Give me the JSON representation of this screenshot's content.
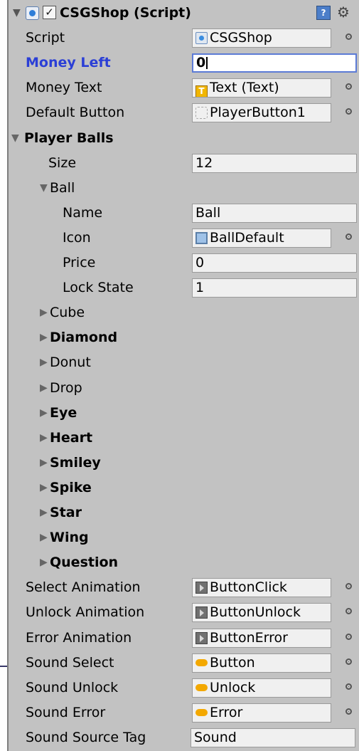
{
  "header": {
    "title": "CSGShop (Script)",
    "foldout": "▼",
    "checkbox": "✓",
    "help_icon": "?",
    "gear_icon": "⚙"
  },
  "fields": {
    "script": {
      "label": "Script",
      "value": "CSGShop"
    },
    "money_left": {
      "label": "Money Left",
      "value": "0"
    },
    "money_text": {
      "label": "Money Text",
      "value": "Text (Text)"
    },
    "default_button": {
      "label": "Default Button",
      "value": "PlayerButton1"
    }
  },
  "player_balls": {
    "label": "Player Balls",
    "size": {
      "label": "Size",
      "value": "12"
    },
    "ball": {
      "label": "Ball",
      "name": {
        "label": "Name",
        "value": "Ball"
      },
      "icon": {
        "label": "Icon",
        "value": "BallDefault"
      },
      "price": {
        "label": "Price",
        "value": "0"
      },
      "lock_state": {
        "label": "Lock State",
        "value": "1"
      }
    },
    "items": [
      "Cube",
      "Diamond",
      "Donut",
      "Drop",
      "Eye",
      "Heart",
      "Smiley",
      "Spike",
      "Star",
      "Wing",
      "Question"
    ]
  },
  "animations": {
    "select": {
      "label": "Select Animation",
      "value": "ButtonClick"
    },
    "unlock": {
      "label": "Unlock Animation",
      "value": "ButtonUnlock"
    },
    "error": {
      "label": "Error Animation",
      "value": "ButtonError"
    }
  },
  "sounds": {
    "select": {
      "label": "Sound Select",
      "value": "Button"
    },
    "unlock": {
      "label": "Sound Unlock",
      "value": "Unlock"
    },
    "error": {
      "label": "Sound Error",
      "value": "Error"
    },
    "source_tag": {
      "label": "Sound Source Tag",
      "value": "Sound"
    }
  },
  "glyphs": {
    "expanded_arrow": "▼",
    "collapsed_arrow": "▶"
  }
}
